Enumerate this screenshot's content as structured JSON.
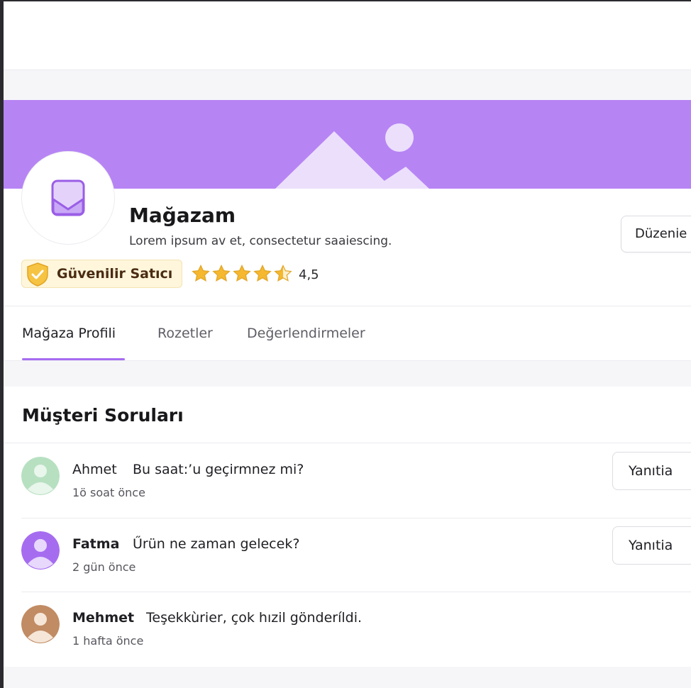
{
  "store": {
    "name": "Mağazam",
    "description": "Lorem ipsum av et, consectetur saaiescing.",
    "edit_label": "Düzenie",
    "badge_label": "Güvenilir Satıcı",
    "rating": 4.5,
    "rating_label": "4,5"
  },
  "tabs": [
    {
      "label": "Mağaza Profili",
      "active": true
    },
    {
      "label": "Rozetler",
      "active": false
    },
    {
      "label": "Değerlendirmeler",
      "active": false
    }
  ],
  "questions": {
    "title": "Müşteri Soruları",
    "items": [
      {
        "author": "Ahmet",
        "text": "Bu saat:’u geçirmnez mi?",
        "time": "1ö soat önce",
        "reply_label": "Yanıtia"
      },
      {
        "author": "Fatma",
        "text": "Űrün ne zaman gelecek?",
        "time": "2 gün önce",
        "reply_label": "Yanıtia"
      },
      {
        "author": "Mehmet",
        "text": "Teşekkùrier, çok hızil gönderíldi.",
        "time": "1 hafta önce"
      }
    ]
  },
  "colors": {
    "banner": "#b784f4",
    "accent": "#a66cf0",
    "star": "#f5b82e",
    "badge_bg": "#fff6dc"
  },
  "icons": {
    "store": "store-icon",
    "banner": "mountain-landscape-icon",
    "badge": "shield-check-icon",
    "star": "star-icon",
    "user": "user-avatar-icon"
  }
}
